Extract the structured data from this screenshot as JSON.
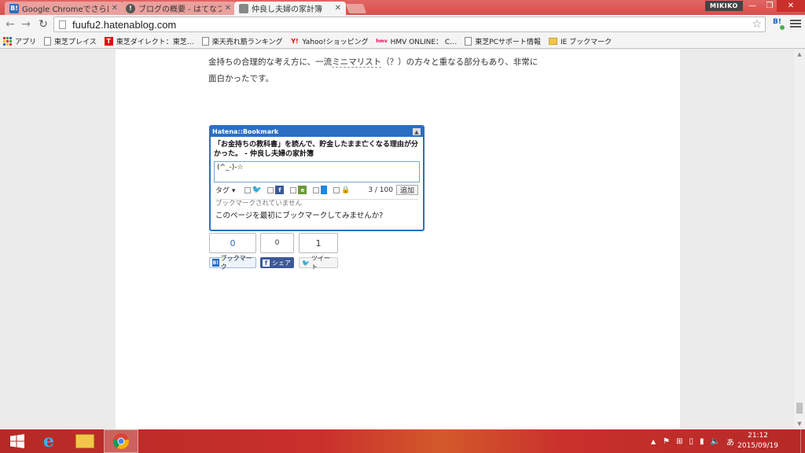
{
  "browser": {
    "tabs": [
      {
        "label": "Google Chromeでさらに快",
        "favicon": "B!",
        "favicon_color": "#2b6fc2"
      },
      {
        "label": "ブログの概要 - はてなブログ",
        "favicon": "!",
        "favicon_color": "#555555"
      },
      {
        "label": "仲良し夫婦の家計簿",
        "favicon": "",
        "favicon_color": "#888888"
      }
    ],
    "profile": "MIKIKO",
    "url": "fuufu2.hatenablog.com"
  },
  "bookmarks": [
    {
      "label": "アプリ",
      "icon": "apps-grid-icon"
    },
    {
      "label": "東芝プレイス",
      "icon": "doc-icon"
    },
    {
      "label": "東芝ダイレクト：東芝…",
      "icon": "toshiba-icon"
    },
    {
      "label": "楽天売れ筋ランキング",
      "icon": "doc-icon"
    },
    {
      "label": "Yahoo!ショッピング",
      "icon": "yahoo-icon"
    },
    {
      "label": "HMV ONLINE： C…",
      "icon": "hmv-icon"
    },
    {
      "label": "東芝PCサポート情報",
      "icon": "doc-icon"
    },
    {
      "label": "IE ブックマーク",
      "icon": "folder-icon"
    }
  ],
  "article": {
    "line1_a": "金持ちの合理的な考え方に、一流",
    "line1_link": "ミニマリスト",
    "line1_b": "（？）の方々と重なる部分もあり、非常に",
    "line2": "面白かったです。"
  },
  "hatena_widget": {
    "header": "Hatena::Bookmark",
    "title": "「お金持ちの教科書」を読んで、貯金したまま亡くなる理由が分かった。 - 仲良し夫婦の家計簿",
    "comment": "(^_-)-☆",
    "tag_label": "タグ",
    "count": "3 / 100",
    "add_button": "追加",
    "status": "ブックマークされていません",
    "invite": "このページを最初にブックマークしてみませんか?"
  },
  "share": {
    "hatena_count": "0",
    "facebook_count": "0",
    "twitter_count": "1",
    "hatena_label": "ブックマーク",
    "facebook_label": "シェア",
    "twitter_label": "ツイート"
  },
  "taskbar": {
    "time": "21:12",
    "date": "2015/09/19",
    "ime": "あ"
  },
  "colors": {
    "accent": "#2b6fc2",
    "titlebar": "#d8504c",
    "taskbar": "#c9302c",
    "facebook": "#3b5998",
    "twitter": "#55acee"
  }
}
